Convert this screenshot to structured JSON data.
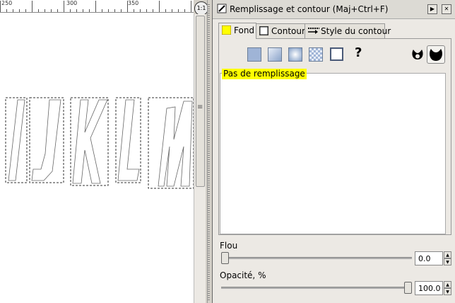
{
  "ruler": {
    "labels": [
      "250",
      "300",
      "350"
    ]
  },
  "canvas": {
    "letters": [
      "I",
      "J",
      "K",
      "L",
      "M"
    ]
  },
  "zoom_label": "1:1",
  "dialog": {
    "title": "Remplissage et contour (Maj+Ctrl+F)",
    "tabs": [
      {
        "label": "Fond",
        "icon": "fill-tab-icon"
      },
      {
        "label": "Contour",
        "icon": "stroke-paint-tab-icon"
      },
      {
        "label": "Style du contour",
        "icon": "stroke-style-tab-icon"
      }
    ],
    "paint_modes": [
      "no-paint",
      "flat-color",
      "linear-gradient",
      "radial-gradient",
      "pattern",
      "swatch",
      "unset"
    ],
    "help_glyph": "?",
    "no_fill_glyph": "✕",
    "no_fill_label": "Pas de remplissage",
    "blur": {
      "label": "Flou",
      "value": "0.0",
      "fraction": 0.0
    },
    "opacity": {
      "label": "Opacité, %",
      "value": "100.0",
      "fraction": 1.0
    }
  },
  "colors": {
    "accent": "#ffff00",
    "swatch": "#9fb4d6"
  }
}
